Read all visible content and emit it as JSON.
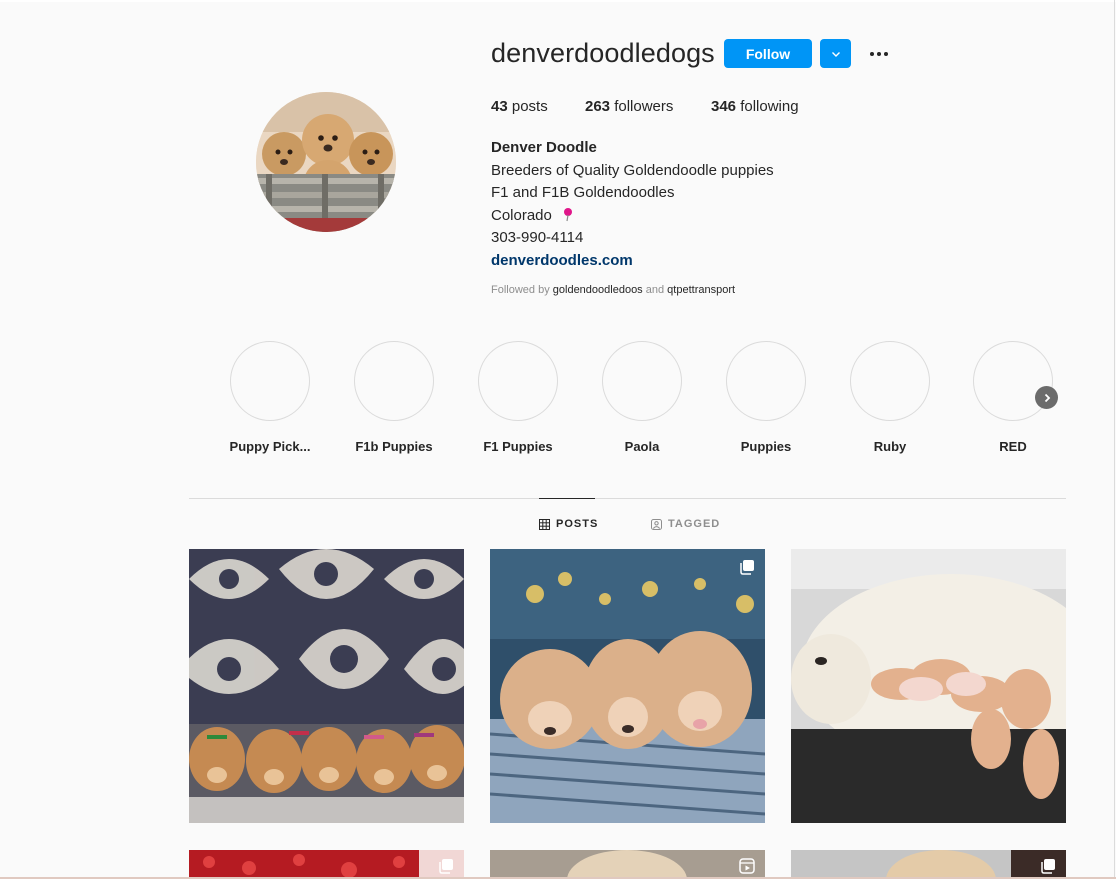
{
  "profile": {
    "username": "denverdoodledogs",
    "follow_label": "Follow",
    "stats": {
      "posts_count": "43",
      "posts_label": "posts",
      "followers_count": "263",
      "followers_label": "followers",
      "following_count": "346",
      "following_label": "following"
    },
    "bio": {
      "name": "Denver Doodle",
      "line1": "Breeders of Quality Goldendoodle puppies",
      "line2": "F1 and F1B Goldendoodles",
      "line3": "Colorado",
      "phone": "303-990-4114",
      "link": "denverdoodles.com"
    },
    "followed_by": {
      "prefix": "Followed by",
      "user1": "goldendoodledoos",
      "conj": "and",
      "user2": "qtpettransport"
    }
  },
  "highlights": [
    {
      "label": "Puppy Pick..."
    },
    {
      "label": "F1b Puppies"
    },
    {
      "label": "F1 Puppies"
    },
    {
      "label": "Paola"
    },
    {
      "label": "Puppies"
    },
    {
      "label": "Ruby"
    },
    {
      "label": "RED"
    }
  ],
  "tabs": {
    "posts": "POSTS",
    "tagged": "TAGGED"
  },
  "colors": {
    "accent": "#0095f6",
    "link": "#00376b",
    "muted": "#8e8e8e",
    "pin": "#e0168a"
  },
  "icons": {
    "more": "more-options-icon",
    "dropdown": "chevron-down-icon",
    "next": "chevron-right-icon",
    "posts_tab": "grid-icon",
    "tagged_tab": "tagged-user-icon",
    "multi": "carousel-icon",
    "reel": "reel-icon"
  }
}
